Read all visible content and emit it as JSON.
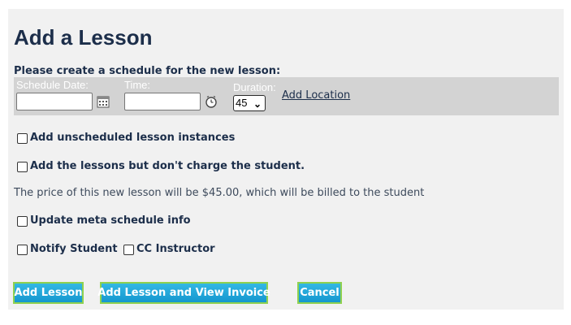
{
  "page": {
    "title": "Add a Lesson",
    "subhead": "Please create a schedule for the new lesson:"
  },
  "schedule": {
    "date_label": "Schedule Date:",
    "date_value": "",
    "time_label": "Time:",
    "time_value": "",
    "duration_label": "Duration:",
    "duration_selected": "45",
    "add_location": "Add Location"
  },
  "options": {
    "unscheduled": {
      "label": "Add unscheduled lesson instances",
      "checked": false
    },
    "no_charge": {
      "label": "Add the lessons but don't charge the student.",
      "checked": false
    },
    "price_note": "The price of this new lesson will be $45.00, which will be billed to the student",
    "meta": {
      "label": "Update meta schedule info",
      "checked": false
    },
    "notify_student": {
      "label": "Notify Student",
      "checked": false
    },
    "cc_instructor": {
      "label": "CC Instructor",
      "checked": false
    }
  },
  "buttons": {
    "add_lesson": "Add Lesson",
    "add_and_view_invoice": "Add Lesson and View Invoice",
    "cancel": "Cancel"
  },
  "icons": {
    "date_picker": "calendar-icon",
    "time_picker": "clock-icon",
    "duration_dropdown": "chevron-down-icon"
  },
  "colors": {
    "title": "#1c2e4a",
    "panel_bg": "#f1f1f1",
    "schedule_bar_bg": "#d3d3d3",
    "button_bg": "#1fa7d9",
    "button_border": "#8fd14f"
  }
}
